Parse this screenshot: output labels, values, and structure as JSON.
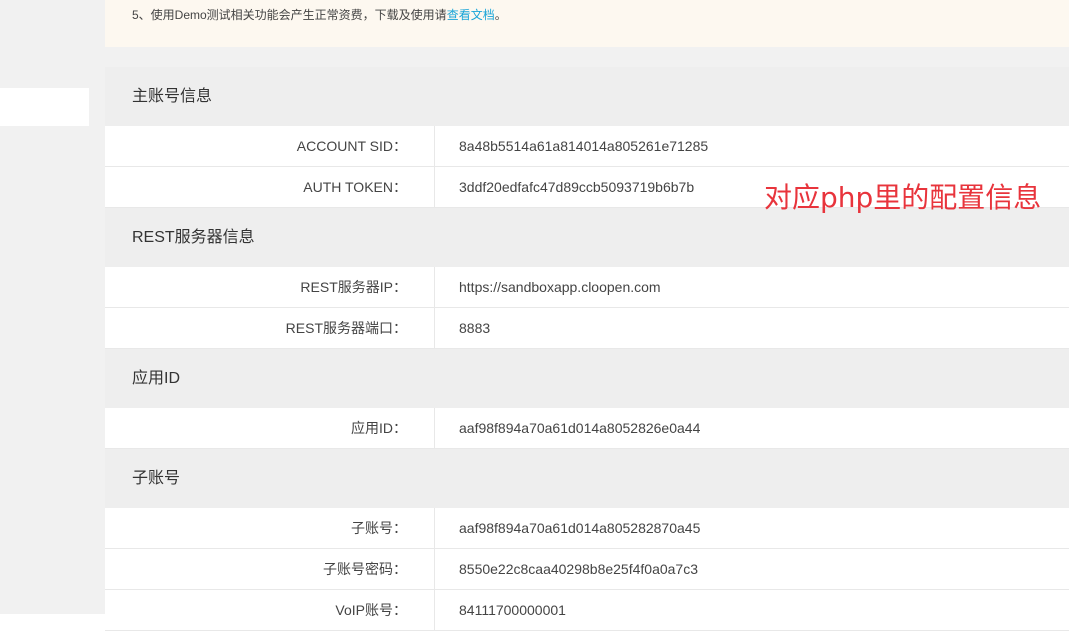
{
  "notice": {
    "text": "5、使用Demo测试相关功能会产生正常资费，下载及使用请",
    "link": "查看文档",
    "suffix": "。"
  },
  "sections": {
    "account": {
      "title": "主账号信息",
      "rows": [
        {
          "label": "ACCOUNT SID：",
          "value": "8a48b5514a61a814014a805261e71285"
        },
        {
          "label": "AUTH TOKEN：",
          "value": "3ddf20edfafc47d89ccb5093719b6b7b"
        }
      ]
    },
    "rest": {
      "title": "REST服务器信息",
      "rows": [
        {
          "label": "REST服务器IP：",
          "value": "https://sandboxapp.cloopen.com"
        },
        {
          "label": "REST服务器端口：",
          "value": "8883"
        }
      ]
    },
    "app": {
      "title": "应用ID",
      "rows": [
        {
          "label": "应用ID：",
          "value": "aaf98f894a70a61d014a8052826e0a44"
        }
      ]
    },
    "subaccount": {
      "title": "子账号",
      "rows": [
        {
          "label": "子账号：",
          "value": "aaf98f894a70a61d014a805282870a45"
        },
        {
          "label": "子账号密码：",
          "value": "8550e22c8caa40298b8e25f4f0a0a7c3"
        },
        {
          "label": "VoIP账号：",
          "value": "84111700000001"
        }
      ]
    }
  },
  "annotation": {
    "text": "对应php里的配置信息",
    "color": "#e8343c"
  }
}
